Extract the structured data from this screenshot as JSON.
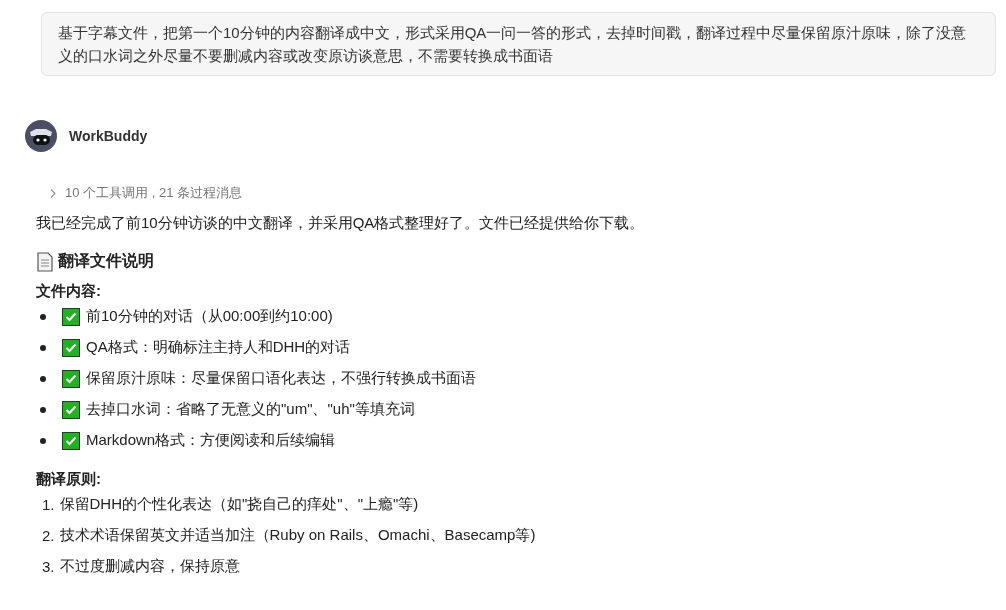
{
  "user_message": "基于字幕文件，把第一个10分钟的内容翻译成中文，形式采用QA一问一答的形式，去掉时间戳，翻译过程中尽量保留原汁原味，除了没意义的口水词之外尽量不要删减内容或改变原访谈意思，不需要转换成书面语",
  "assistant": {
    "name": "WorkBuddy",
    "tool_summary": {
      "expanded": false,
      "text": "10 个工具调用 , 21 条过程消息"
    },
    "intro": "我已经完成了前10分钟访谈的中文翻译，并采用QA格式整理好了。文件已经提供给你下载。",
    "heading": "翻译文件说明",
    "sections": [
      {
        "title": "文件内容:",
        "kind": "bullets",
        "items": [
          {
            "text": "前10分钟的对话（从00:00到约10:00)",
            "checked": true
          },
          {
            "text": "QA格式：明确标注主持人和DHH的对话",
            "checked": true
          },
          {
            "text": "保留原汁原味：尽量保留口语化表达，不强行转换成书面语",
            "checked": true
          },
          {
            "text": "去掉口水词：省略了无意义的\"um\"、\"uh\"等填充词",
            "checked": true
          },
          {
            "text": "Markdown格式：方便阅读和后续编辑",
            "checked": true
          }
        ]
      },
      {
        "title": "翻译原则:",
        "kind": "numbered",
        "items": [
          {
            "number": "1.",
            "text": "保留DHH的个性化表达（如\"挠自己的痒处\"、\"上瘾\"等)"
          },
          {
            "number": "2.",
            "text": "技术术语保留英文并适当加注（Ruby on Rails、Omachi、Basecamp等)"
          },
          {
            "number": "3.",
            "text": "不过度删减内容，保持原意"
          }
        ]
      }
    ]
  }
}
